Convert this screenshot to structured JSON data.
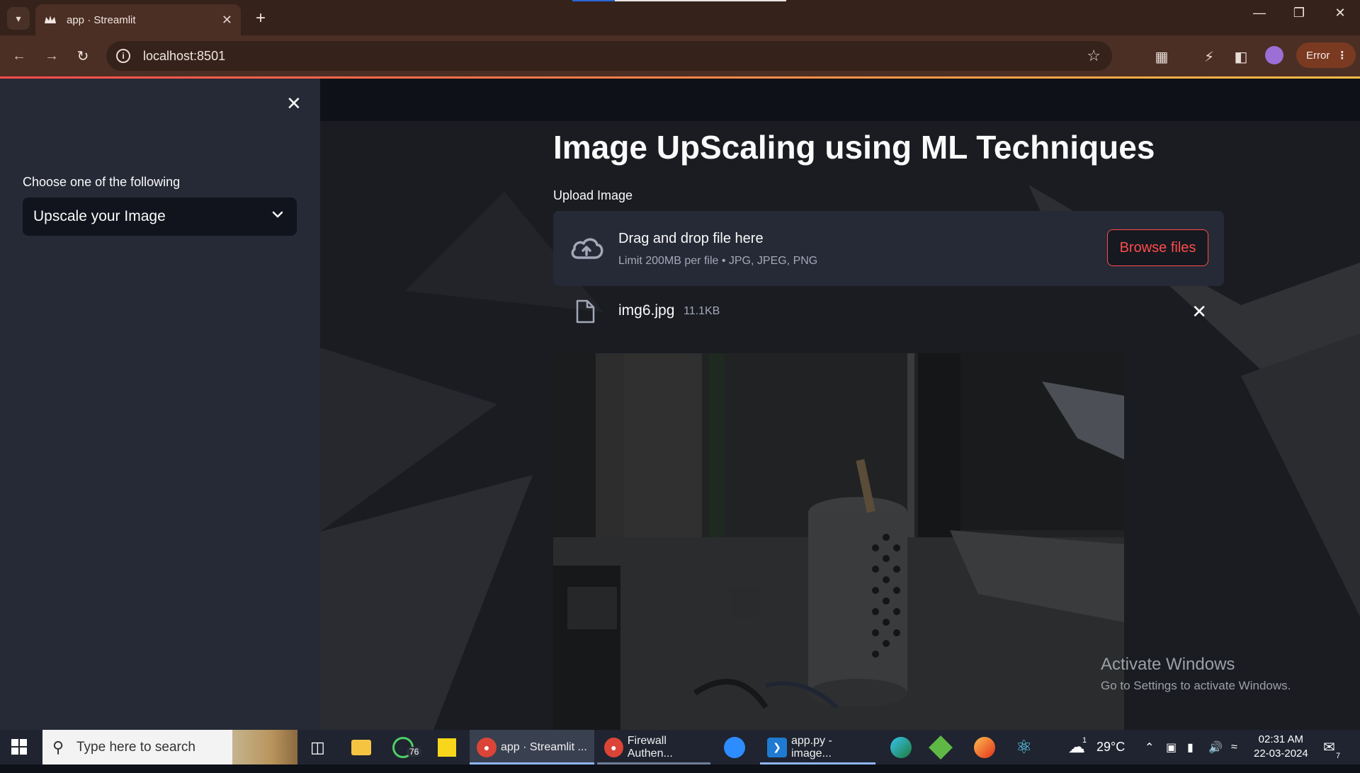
{
  "browser": {
    "tab_title": "app · Streamlit",
    "url": "localhost:8501",
    "error_label": "Error"
  },
  "sidebar": {
    "label": "Choose one of the following",
    "selected_option": "Upscale your Image"
  },
  "main": {
    "title": "Image UpScaling using ML Techniques",
    "upload_label": "Upload Image",
    "dropzone_title": "Drag and drop file here",
    "dropzone_limit": "Limit 200MB per file • JPG, JPEG, PNG",
    "browse_button": "Browse files",
    "file_name": "img6.jpg",
    "file_size": "11.1KB"
  },
  "watermark": {
    "line1": "Activate Windows",
    "line2": "Go to Settings to activate Windows."
  },
  "taskbar": {
    "search_placeholder": "Type here to search",
    "whatsapp_badge": "76",
    "tasks": [
      "app · Streamlit ...",
      "Firewall Authen...",
      "app.py - image..."
    ],
    "weather": "29°C",
    "weather_badge": "1",
    "time": "02:31 AM",
    "date": "22-03-2024",
    "notification_count": "7"
  },
  "colors": {
    "accent": "#ff4b4b",
    "sidebar_bg": "#262a36",
    "app_bg": "#0e1117",
    "browser_frame": "#4b2e24"
  }
}
